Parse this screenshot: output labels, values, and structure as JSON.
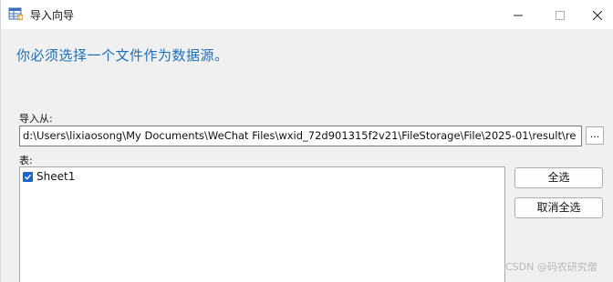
{
  "window": {
    "title": "导入向导",
    "icon": "table-import-icon"
  },
  "controls": {
    "minimize_icon": "minimize-icon",
    "maximize_icon": "maximize-icon",
    "close_icon": "close-icon"
  },
  "main": {
    "heading": "你必须选择一个文件作为数据源。",
    "import_from_label": "导入从:",
    "path_value": "d:\\Users\\lixiaosong\\My Documents\\WeChat Files\\wxid_72d901315f2v21\\FileStorage\\File\\2025-01\\result\\re",
    "browse_label": "...",
    "table_label": "表:",
    "sheets": [
      {
        "label": "Sheet1",
        "checked": true
      }
    ],
    "select_all_label": "全选",
    "deselect_all_label": "取消全选"
  },
  "watermark": "CSDN @码农研究僧",
  "colors": {
    "heading": "#1e6fb8",
    "checkbox": "#1a66c9",
    "panel_bg": "#f0f0f0"
  }
}
